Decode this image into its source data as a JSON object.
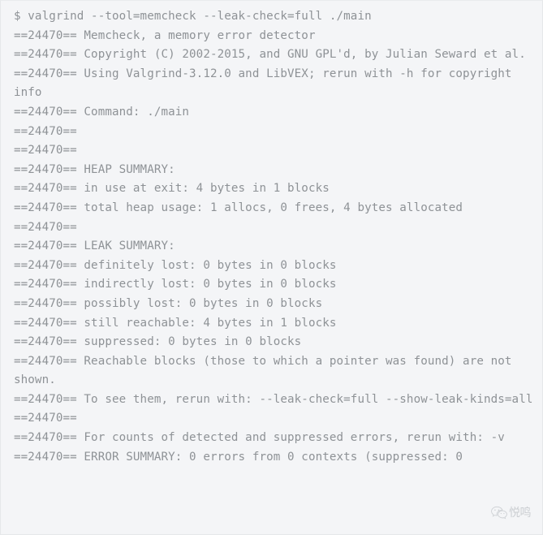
{
  "terminal": {
    "background_color": "#f4f5f7",
    "border_color": "#e6e8ea",
    "text_color": "#8e9296",
    "prompt_symbol": "$",
    "pid_tag": "==24470==",
    "lines": [
      "$ valgrind --tool=memcheck --leak-check=full ./main",
      "==24470== Memcheck, a memory error detector",
      "==24470== Copyright (C) 2002-2015, and GNU GPL'd, by Julian Seward et al.",
      "==24470== Using Valgrind-3.12.0 and LibVEX; rerun with -h for copyright info",
      "==24470== Command: ./main",
      "==24470== ",
      "==24470== ",
      "==24470== HEAP SUMMARY:",
      "==24470== in use at exit: 4 bytes in 1 blocks",
      "==24470== total heap usage: 1 allocs, 0 frees, 4 bytes allocated",
      "==24470== ",
      "==24470== LEAK SUMMARY:",
      "==24470== definitely lost: 0 bytes in 0 blocks",
      "==24470== indirectly lost: 0 bytes in 0 blocks",
      "==24470== possibly lost: 0 bytes in 0 blocks",
      "==24470== still reachable: 4 bytes in 1 blocks",
      "==24470== suppressed: 0 bytes in 0 blocks",
      "==24470== Reachable blocks (those to which a pointer was found) are not shown.",
      "==24470== To see them, rerun with: --leak-check=full --show-leak-kinds=all",
      "==24470== ",
      "==24470== For counts of detected and suppressed errors, rerun with: -v",
      "==24470== ERROR SUMMARY: 0 errors from 0 contexts (suppressed: 0"
    ]
  },
  "watermark": {
    "icon": "wechat-icon",
    "label": "悦鸣"
  }
}
